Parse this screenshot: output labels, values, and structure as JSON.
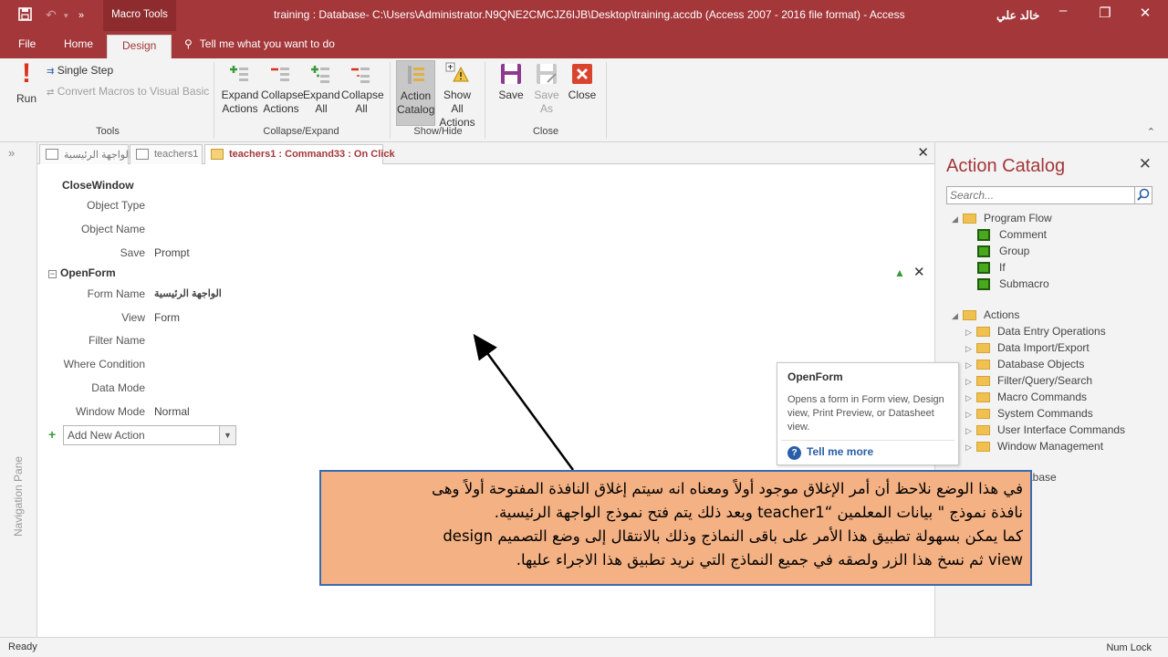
{
  "titlebar": {
    "context_tab": "Macro Tools",
    "title": "training : Database- C:\\Users\\Administrator.N9QNE2CMCJZ6IJB\\Desktop\\training.accdb (Access 2007 - 2016 file format)  -  Access",
    "user": "خالد علي",
    "color": "#a4373a"
  },
  "tabs": {
    "file": "File",
    "home": "Home",
    "design": "Design",
    "tell_me": "Tell me what you want to do"
  },
  "ribbon": {
    "run": "Run",
    "single_step": "Single Step",
    "convert": "Convert Macros to Visual Basic",
    "tools_label": "Tools",
    "expand_actions_1": "Expand",
    "expand_actions_2": "Actions",
    "collapse_actions_1": "Collapse",
    "collapse_actions_2": "Actions",
    "expand_all_1": "Expand",
    "expand_all_2": "All",
    "collapse_all_1": "Collapse",
    "collapse_all_2": "All",
    "collapse_expand_label": "Collapse/Expand",
    "action_catalog_1": "Action",
    "action_catalog_2": "Catalog",
    "show_all_1": "Show All",
    "show_all_2": "Actions",
    "show_hide_label": "Show/Hide",
    "save": "Save",
    "save_as_1": "Save",
    "save_as_2": "As",
    "close": "Close",
    "close_label": "Close"
  },
  "nav_pane": {
    "label": "Navigation Pane"
  },
  "doc_tabs": [
    {
      "label": "الواجهة الرئيسية"
    },
    {
      "label": "teachers1"
    },
    {
      "label": "teachers1 : Command33 : On Click"
    }
  ],
  "macro": {
    "close_window": {
      "name": "CloseWindow",
      "object_type_label": "Object Type",
      "object_name_label": "Object Name",
      "save_label": "Save",
      "save_value": "Prompt"
    },
    "open_form": {
      "name": "OpenForm",
      "form_name_label": "Form Name",
      "form_name_value": "الواجهة الرئيسية",
      "view_label": "View",
      "view_value": "Form",
      "filter_name_label": "Filter Name",
      "where_label": "Where Condition",
      "data_mode_label": "Data Mode",
      "window_mode_label": "Window Mode",
      "window_mode_value": "Normal"
    },
    "add_new_action": "Add New Action"
  },
  "catalog": {
    "title": "Action Catalog",
    "search_placeholder": "Search...",
    "program_flow": "Program Flow",
    "flow_items": [
      "Comment",
      "Group",
      "If",
      "Submacro"
    ],
    "actions": "Actions",
    "action_groups": [
      "Data Entry Operations",
      "Data Import/Export",
      "Database Objects",
      "Filter/Query/Search",
      "Macro Commands",
      "System Commands",
      "User Interface Commands",
      "Window Management"
    ],
    "partial_database": "abase"
  },
  "tooltip": {
    "title": "OpenForm",
    "description": "Opens a form in Form view, Design view, Print Preview, or Datasheet view.",
    "link": "Tell me more"
  },
  "callout": {
    "line1": "في هذا الوضع نلاحظ أن أمر الإغلاق موجود أولاً ومعناه انه سيتم إغلاق النافذة المفتوحة أولاً وهى",
    "line2": "نافذة نموذج \" بيانات المعلمين “teacher1 وبعد ذلك يتم فتح نموذج الواجهة الرئيسية.",
    "line3": "كما يمكن بسهولة تطبيق هذا الأمر على باقى النماذج وذلك بالانتقال إلى وضع التصميم design",
    "line4": "view ثم نسخ هذا الزر ولصقه في جميع النماذج التي نريد تطبيق هذا الاجراء عليها."
  },
  "status": {
    "left": "Ready",
    "right": "Num Lock"
  }
}
